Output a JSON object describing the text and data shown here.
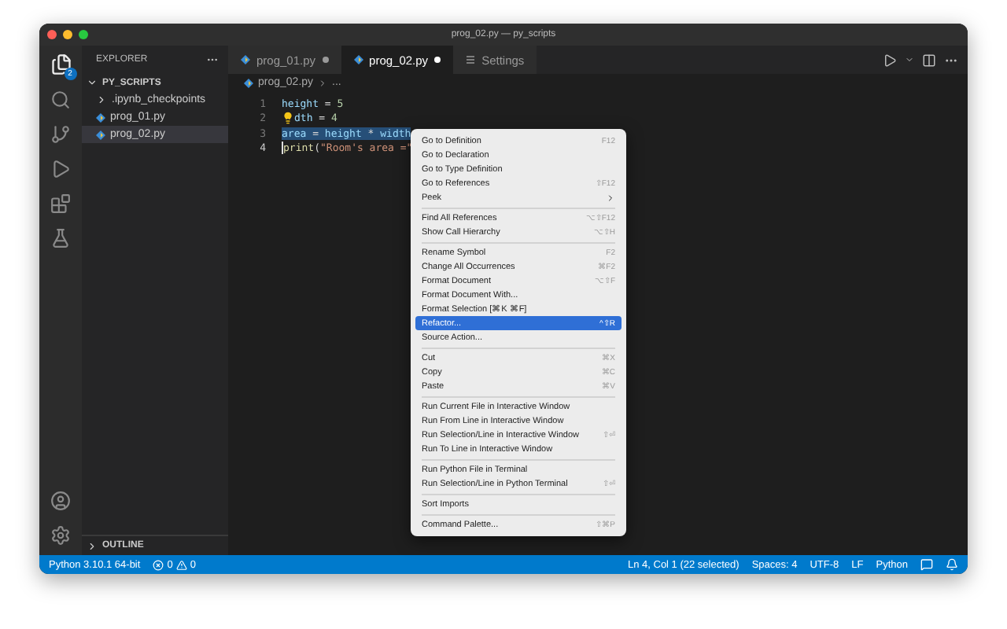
{
  "window": {
    "title": "prog_02.py — py_scripts"
  },
  "activity_bar": {
    "explorer_badge": "2"
  },
  "sidebar": {
    "title": "EXPLORER",
    "folder": {
      "name": "PY_SCRIPTS",
      "expanded": true,
      "children": [
        {
          "name": ".ipynb_checkpoints",
          "kind": "folder",
          "selected": false
        },
        {
          "name": "prog_01.py",
          "kind": "python",
          "selected": false
        },
        {
          "name": "prog_02.py",
          "kind": "python",
          "selected": true
        }
      ]
    },
    "outline": {
      "label": "OUTLINE",
      "expanded": false
    }
  },
  "tabs": [
    {
      "label": "prog_01.py",
      "kind": "python",
      "modified": true,
      "selected": false
    },
    {
      "label": "prog_02.py",
      "kind": "python",
      "modified": true,
      "selected": true
    },
    {
      "label": "Settings",
      "kind": "settings",
      "modified": false,
      "selected": false
    }
  ],
  "breadcrumb": [
    "prog_02.py",
    "..."
  ],
  "code": [
    {
      "number": "1",
      "selected": false,
      "lightbulb": false,
      "cursor": false,
      "tokens": [
        {
          "text": "height",
          "kind": "variable"
        },
        {
          "text": " = ",
          "kind": "plain"
        },
        {
          "text": "5",
          "kind": "number"
        }
      ]
    },
    {
      "number": "2",
      "selected": false,
      "lightbulb": true,
      "cursor": false,
      "tokens": [
        {
          "text": "dth",
          "kind": "variable"
        },
        {
          "text": " = ",
          "kind": "plain"
        },
        {
          "text": "4",
          "kind": "number"
        }
      ]
    },
    {
      "number": "3",
      "selected": true,
      "lightbulb": false,
      "cursor": false,
      "tokens": [
        {
          "text": "area",
          "kind": "variable"
        },
        {
          "text": " = ",
          "kind": "plain"
        },
        {
          "text": "height",
          "kind": "variable"
        },
        {
          "text": " * ",
          "kind": "plain"
        },
        {
          "text": "width",
          "kind": "variable"
        }
      ]
    },
    {
      "number": "4",
      "selected": false,
      "lightbulb": false,
      "cursor": true,
      "tokens": [
        {
          "text": "print",
          "kind": "function"
        },
        {
          "text": "(",
          "kind": "plain"
        },
        {
          "text": "\"Room's area =\"",
          "kind": "string"
        }
      ]
    }
  ],
  "context_menu": [
    [
      {
        "label": "Go to Definition",
        "shortcut": "F12",
        "selected": false,
        "submenu": false
      },
      {
        "label": "Go to Declaration",
        "selected": false,
        "submenu": false
      },
      {
        "label": "Go to Type Definition",
        "selected": false,
        "submenu": false
      },
      {
        "label": "Go to References",
        "shortcut": "⇧F12",
        "selected": false,
        "submenu": false
      },
      {
        "label": "Peek",
        "selected": false,
        "submenu": true
      }
    ],
    [
      {
        "label": "Find All References",
        "shortcut": "⌥⇧F12",
        "selected": false,
        "submenu": false
      },
      {
        "label": "Show Call Hierarchy",
        "shortcut": "⌥⇧H",
        "selected": false,
        "submenu": false
      }
    ],
    [
      {
        "label": "Rename Symbol",
        "shortcut": "F2",
        "selected": false,
        "submenu": false
      },
      {
        "label": "Change All Occurrences",
        "shortcut": "⌘F2",
        "selected": false,
        "submenu": false
      },
      {
        "label": "Format Document",
        "shortcut": "⌥⇧F",
        "selected": false,
        "submenu": false
      },
      {
        "label": "Format Document With...",
        "selected": false,
        "submenu": false
      },
      {
        "label": "Format Selection [⌘K ⌘F]",
        "selected": false,
        "submenu": false
      },
      {
        "label": "Refactor...",
        "shortcut": "^⇧R",
        "selected": true,
        "submenu": false
      },
      {
        "label": "Source Action...",
        "selected": false,
        "submenu": false
      }
    ],
    [
      {
        "label": "Cut",
        "shortcut": "⌘X",
        "selected": false,
        "submenu": false
      },
      {
        "label": "Copy",
        "shortcut": "⌘C",
        "selected": false,
        "submenu": false
      },
      {
        "label": "Paste",
        "shortcut": "⌘V",
        "selected": false,
        "submenu": false
      }
    ],
    [
      {
        "label": "Run Current File in Interactive Window",
        "selected": false,
        "submenu": false
      },
      {
        "label": "Run From Line in Interactive Window",
        "selected": false,
        "submenu": false
      },
      {
        "label": "Run Selection/Line in Interactive Window",
        "shortcut": "⇧⏎",
        "selected": false,
        "submenu": false
      },
      {
        "label": "Run To Line in Interactive Window",
        "selected": false,
        "submenu": false
      }
    ],
    [
      {
        "label": "Run Python File in Terminal",
        "selected": false,
        "submenu": false
      },
      {
        "label": "Run Selection/Line in Python Terminal",
        "shortcut": "⇧⏎",
        "selected": false,
        "submenu": false
      }
    ],
    [
      {
        "label": "Sort Imports",
        "selected": false,
        "submenu": false
      }
    ],
    [
      {
        "label": "Command Palette...",
        "shortcut": "⇧⌘P",
        "selected": false,
        "submenu": false
      }
    ]
  ],
  "status_bar": {
    "interpreter": "Python 3.10.1 64-bit",
    "errors": "0",
    "warnings": "0",
    "right": [
      "Ln 4, Col 1 (22 selected)",
      "Spaces: 4",
      "UTF-8",
      "LF",
      "Python"
    ]
  }
}
